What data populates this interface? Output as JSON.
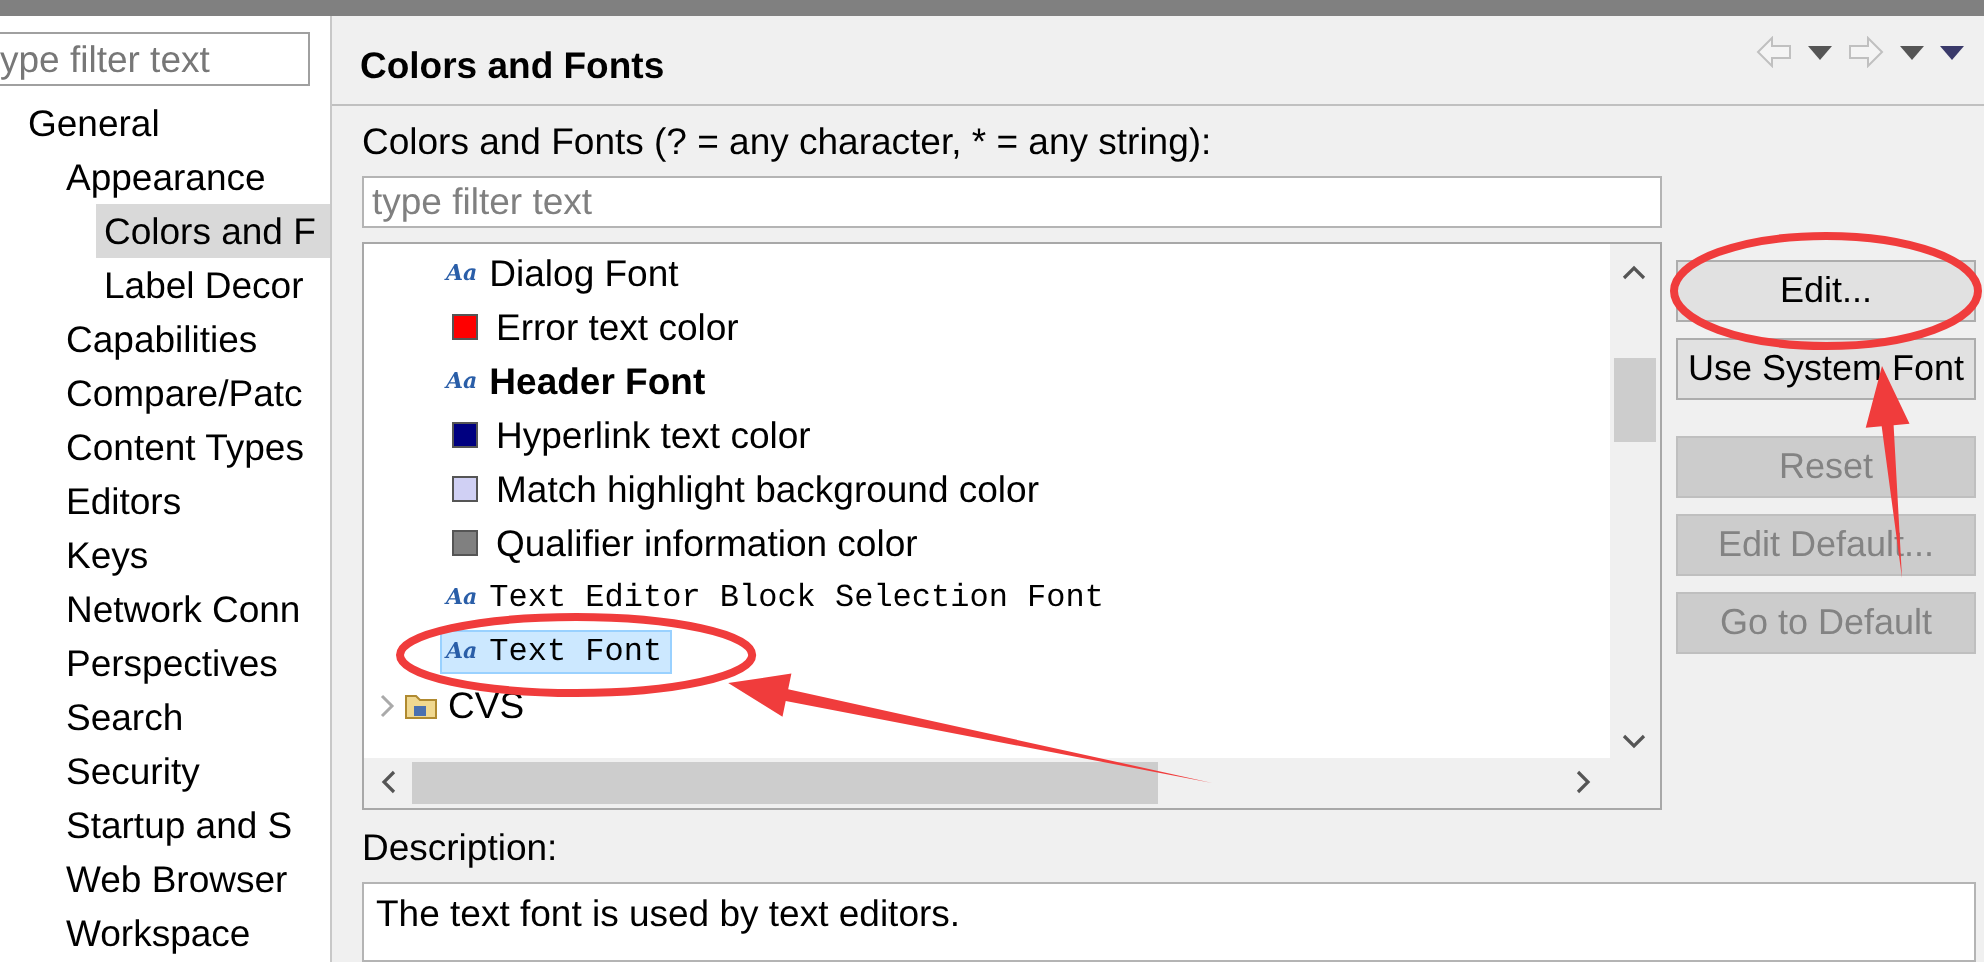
{
  "left_pane": {
    "filter": {
      "placeholder": "ype filter text"
    },
    "tree": [
      {
        "label": "General",
        "selected": false,
        "children": [
          {
            "label": "Appearance",
            "selected": false,
            "children": [
              {
                "label": "Colors and F",
                "selected": true
              },
              {
                "label": "Label Decor",
                "selected": false
              }
            ]
          },
          {
            "label": "Capabilities",
            "selected": false
          },
          {
            "label": "Compare/Patc",
            "selected": false
          },
          {
            "label": "Content Types",
            "selected": false
          },
          {
            "label": "Editors",
            "selected": false
          },
          {
            "label": "Keys",
            "selected": false
          },
          {
            "label": "Network Conn",
            "selected": false
          },
          {
            "label": "Perspectives",
            "selected": false
          },
          {
            "label": "Search",
            "selected": false
          },
          {
            "label": "Security",
            "selected": false
          },
          {
            "label": "Startup and S",
            "selected": false
          },
          {
            "label": "Web Browser",
            "selected": false
          },
          {
            "label": "Workspace",
            "selected": false
          }
        ]
      }
    ]
  },
  "page": {
    "title": "Colors and Fonts",
    "filter_label": "Colors and Fonts (? = any character, * = any string):",
    "filter": {
      "placeholder": "type filter text"
    },
    "list": [
      {
        "kind": "font",
        "glyph": "Aa",
        "label": "Dialog Font",
        "selected": false
      },
      {
        "kind": "color",
        "color": "#ff0000",
        "label": "Error text color",
        "selected": false
      },
      {
        "kind": "boldfont",
        "glyph": "Aa",
        "label": "Header Font",
        "selected": false
      },
      {
        "kind": "color",
        "color": "#000080",
        "label": "Hyperlink text color",
        "selected": false
      },
      {
        "kind": "color",
        "color": "#d0d0f4",
        "label": "Match highlight background color",
        "selected": false
      },
      {
        "kind": "color",
        "color": "#808080",
        "label": "Qualifier information color",
        "selected": false
      },
      {
        "kind": "monofont",
        "glyph": "Aa",
        "label": "Text Editor Block Selection Font",
        "selected": false
      },
      {
        "kind": "monofont",
        "glyph": "Aa",
        "label": "Text Font",
        "selected": true,
        "circled": true
      },
      {
        "kind": "category",
        "label": "CVS",
        "expanded": false,
        "selected": false
      }
    ],
    "buttons": [
      {
        "label": "Edit...",
        "disabled": false,
        "circled": true
      },
      {
        "label": "Use System Font",
        "disabled": false
      },
      {
        "label": "Reset",
        "disabled": true
      },
      {
        "label": "Edit Default...",
        "disabled": true
      },
      {
        "label": "Go to Default",
        "disabled": true
      }
    ],
    "description_label": "Description:",
    "description": "The text font is used by text editors."
  }
}
